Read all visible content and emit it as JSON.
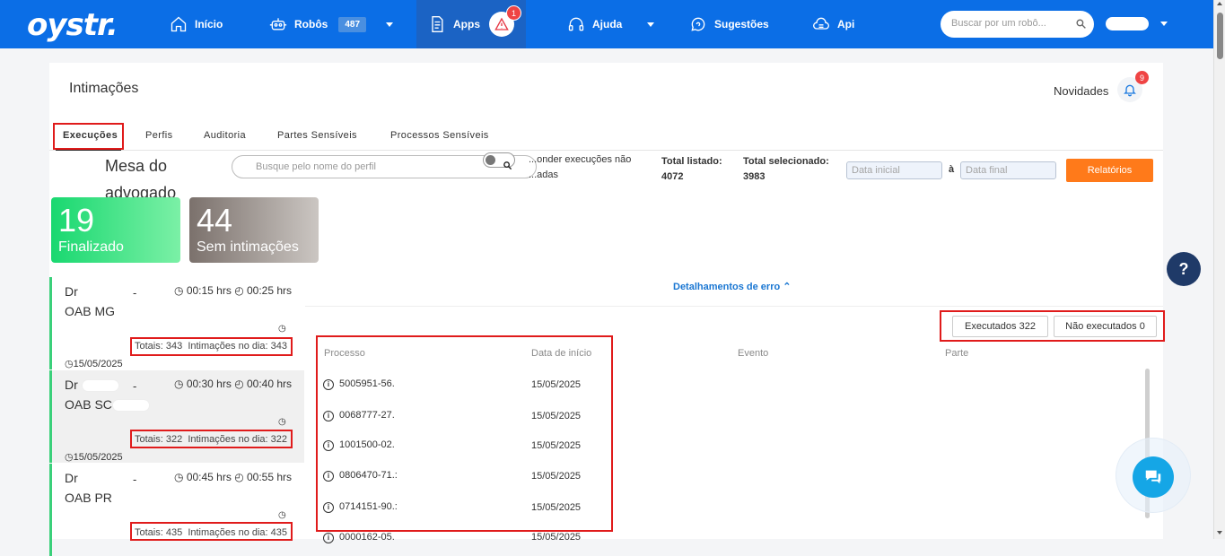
{
  "app": {
    "logo": "oystr."
  },
  "nav": {
    "inicio": "Início",
    "robos": "Robôs",
    "robos_count": "487",
    "apps": "Apps",
    "apps_alert_count": "1",
    "ajuda": "Ajuda",
    "sugestoes": "Sugestões",
    "api": "Api",
    "search_placeholder": "Buscar por um robô..."
  },
  "page": {
    "title": "Intimações",
    "novidades": "Novidades",
    "novidades_count": "9",
    "tabs": [
      "Execuções",
      "Perfis",
      "Auditoria",
      "Partes Sensíveis",
      "Processos Sensíveis"
    ]
  },
  "filters": {
    "mesa_title": "Mesa do advogado",
    "perfil_placeholder": "Busque pelo nome do perfil",
    "esconder_label": "...onder execuções não ...adas",
    "total_listado_label": "Total listado:",
    "total_listado_value": "4072",
    "total_selecionado_label": "Total selecionado:",
    "total_selecionado_value": "3983",
    "data_inicial_placeholder": "Data inicial",
    "date_separator": "à",
    "data_final_placeholder": "Data final",
    "relatorios_label": "Relatórios"
  },
  "stats": [
    {
      "num": "19",
      "label": "Finalizado",
      "color": "#19d870"
    },
    {
      "num": "44",
      "label": "Sem intimações",
      "color": "#7b716c"
    }
  ],
  "list": [
    {
      "dr": "Dr",
      "oab": "OAB MG",
      "dash": "-",
      "t1": "00:15 hrs",
      "t2": "00:25 hrs",
      "totais": "Totais: 343",
      "intimacoes": "Intimações no dia: 343",
      "date": "15/05/2025"
    },
    {
      "dr": "Dr",
      "oab": "OAB SC",
      "dash": "-",
      "t1": "00:30 hrs",
      "t2": "00:40 hrs",
      "totais": "Totais: 322",
      "intimacoes": "Intimações no dia: 322",
      "date": "15/05/2025"
    },
    {
      "dr": "Dr",
      "oab": "OAB PR",
      "dash": "-",
      "t1": "00:45 hrs",
      "t2": "00:55 hrs",
      "totais": "Totais: 435",
      "intimacoes": "Intimações no dia: 435",
      "date": ""
    }
  ],
  "detail": {
    "detalhamentos": "Detalhamentos de erro",
    "executados": "Executados 322",
    "nao_executados": "Não executados 0",
    "columns": [
      "Processo",
      "Data de início",
      "Evento",
      "Parte"
    ],
    "rows": [
      {
        "processo": "5005951-56.",
        "data": "15/05/2025"
      },
      {
        "processo": "0068777-27.",
        "data": "15/05/2025"
      },
      {
        "processo": "1001500-02.",
        "data": "15/05/2025"
      },
      {
        "processo": "0806470-71.:",
        "data": "15/05/2025"
      },
      {
        "processo": "0714151-90.:",
        "data": "15/05/2025"
      },
      {
        "processo": "0000162-05.",
        "data": "15/05/2025"
      }
    ]
  },
  "colors": {
    "brand": "#0b6ee6",
    "highlight_box": "#e01b1b",
    "orange": "#ff7a1a",
    "navy": "#1f3a68",
    "chat": "#15a6e6"
  }
}
